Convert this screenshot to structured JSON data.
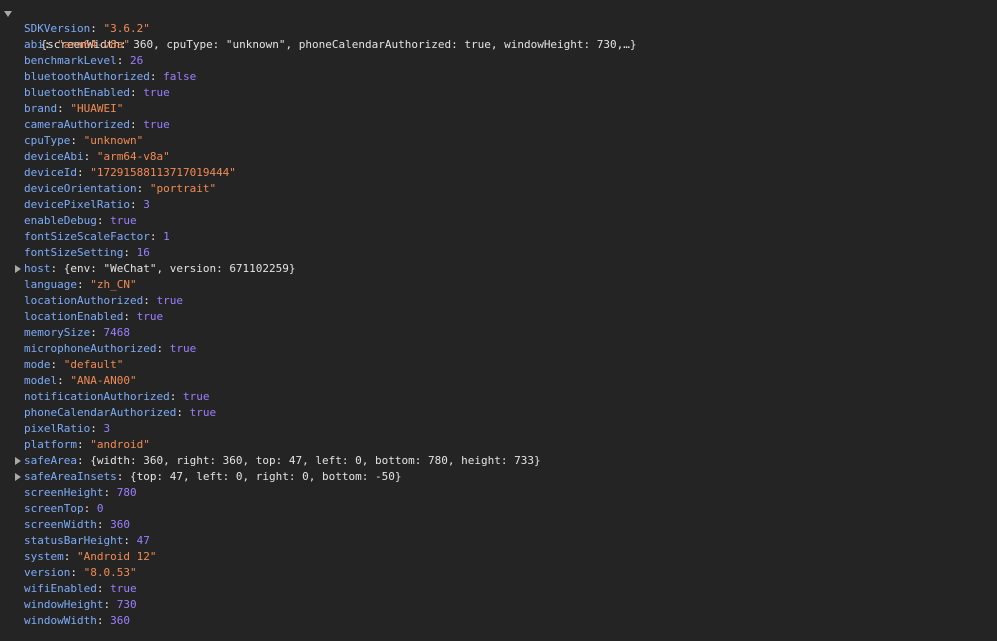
{
  "summary": "{screenWidth: 360, cpuType: \"unknown\", phoneCalendarAuthorized: true, windowHeight: 730,…}",
  "host_preview": "{env: \"WeChat\", version: 671102259}",
  "safeArea_preview": "{width: 360, right: 360, top: 47, left: 0, bottom: 780, height: 733}",
  "safeAreaInsets_preview": "{top: 47, left: 0, right: 0, bottom: -50}",
  "props": [
    {
      "key": "SDKVersion",
      "value": "\"3.6.2\"",
      "type": "str"
    },
    {
      "key": "abi",
      "value": "\"arm64-v8a\"",
      "type": "str"
    },
    {
      "key": "benchmarkLevel",
      "value": "26",
      "type": "num"
    },
    {
      "key": "bluetoothAuthorized",
      "value": "false",
      "type": "bool"
    },
    {
      "key": "bluetoothEnabled",
      "value": "true",
      "type": "bool"
    },
    {
      "key": "brand",
      "value": "\"HUAWEI\"",
      "type": "str"
    },
    {
      "key": "cameraAuthorized",
      "value": "true",
      "type": "bool"
    },
    {
      "key": "cpuType",
      "value": "\"unknown\"",
      "type": "str"
    },
    {
      "key": "deviceAbi",
      "value": "\"arm64-v8a\"",
      "type": "str"
    },
    {
      "key": "deviceId",
      "value": "\"17291588113717019444\"",
      "type": "str"
    },
    {
      "key": "deviceOrientation",
      "value": "\"portrait\"",
      "type": "str"
    },
    {
      "key": "devicePixelRatio",
      "value": "3",
      "type": "num"
    },
    {
      "key": "enableDebug",
      "value": "true",
      "type": "bool"
    },
    {
      "key": "fontSizeScaleFactor",
      "value": "1",
      "type": "num"
    },
    {
      "key": "fontSizeSetting",
      "value": "16",
      "type": "num"
    },
    {
      "key": "host",
      "value": "{env: \"WeChat\", version: 671102259}",
      "type": "obj"
    },
    {
      "key": "language",
      "value": "\"zh_CN\"",
      "type": "str"
    },
    {
      "key": "locationAuthorized",
      "value": "true",
      "type": "bool"
    },
    {
      "key": "locationEnabled",
      "value": "true",
      "type": "bool"
    },
    {
      "key": "memorySize",
      "value": "7468",
      "type": "num"
    },
    {
      "key": "microphoneAuthorized",
      "value": "true",
      "type": "bool"
    },
    {
      "key": "mode",
      "value": "\"default\"",
      "type": "str"
    },
    {
      "key": "model",
      "value": "\"ANA-AN00\"",
      "type": "str"
    },
    {
      "key": "notificationAuthorized",
      "value": "true",
      "type": "bool"
    },
    {
      "key": "phoneCalendarAuthorized",
      "value": "true",
      "type": "bool"
    },
    {
      "key": "pixelRatio",
      "value": "3",
      "type": "num"
    },
    {
      "key": "platform",
      "value": "\"android\"",
      "type": "str"
    },
    {
      "key": "safeArea",
      "value": "{width: 360, right: 360, top: 47, left: 0, bottom: 780, height: 733}",
      "type": "obj"
    },
    {
      "key": "safeAreaInsets",
      "value": "{top: 47, left: 0, right: 0, bottom: -50}",
      "type": "obj"
    },
    {
      "key": "screenHeight",
      "value": "780",
      "type": "num"
    },
    {
      "key": "screenTop",
      "value": "0",
      "type": "num"
    },
    {
      "key": "screenWidth",
      "value": "360",
      "type": "num"
    },
    {
      "key": "statusBarHeight",
      "value": "47",
      "type": "num"
    },
    {
      "key": "system",
      "value": "\"Android 12\"",
      "type": "str"
    },
    {
      "key": "version",
      "value": "\"8.0.53\"",
      "type": "str"
    },
    {
      "key": "wifiEnabled",
      "value": "true",
      "type": "bool"
    },
    {
      "key": "windowHeight",
      "value": "730",
      "type": "num"
    },
    {
      "key": "windowWidth",
      "value": "360",
      "type": "num"
    }
  ]
}
